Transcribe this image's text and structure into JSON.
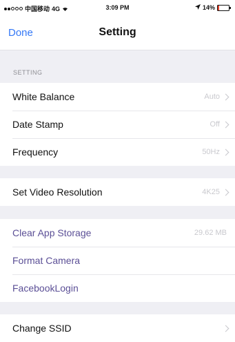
{
  "status_bar": {
    "carrier": "中国移动",
    "network": "4G",
    "time": "3:09 PM",
    "battery": "14%",
    "battery_level": 0.14
  },
  "nav": {
    "done_label": "Done",
    "title": "Setting"
  },
  "section_header": "SETTING",
  "groups": [
    {
      "rows": [
        {
          "label": "White Balance",
          "value": "Auto"
        },
        {
          "label": "Date Stamp",
          "value": "Off"
        },
        {
          "label": "Frequency",
          "value": "50Hz"
        }
      ]
    },
    {
      "rows": [
        {
          "label": "Set Video Resolution",
          "value": "4K25"
        }
      ]
    },
    {
      "rows": [
        {
          "label": "Clear App Storage",
          "value": "29.62 MB"
        },
        {
          "label": "Format Camera"
        },
        {
          "label": "FacebookLogin"
        }
      ]
    },
    {
      "rows": [
        {
          "label": "Change SSID"
        }
      ]
    }
  ],
  "colors": {
    "accent": "#3478f6",
    "action_text": "#5b4f96",
    "background": "#efeff4"
  }
}
